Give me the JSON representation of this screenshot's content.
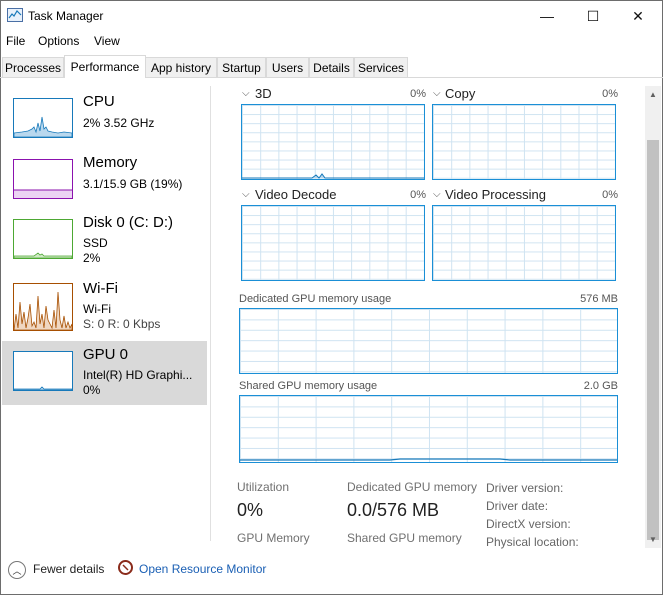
{
  "window": {
    "title": "Task Manager"
  },
  "controls": {
    "minimize": "—",
    "maximize": "☐",
    "close": "✕"
  },
  "menu": [
    "File",
    "Options",
    "View"
  ],
  "tabs": [
    "Processes",
    "Performance",
    "App history",
    "Startup",
    "Users",
    "Details",
    "Services"
  ],
  "active_tab": "Performance",
  "sidebar": {
    "items": [
      {
        "name": "CPU",
        "line1": "2%  3.52 GHz",
        "line2": "",
        "color": "#1779ba"
      },
      {
        "name": "Memory",
        "line1": "3.1/15.9 GB (19%)",
        "line2": "",
        "color": "#8b12ae"
      },
      {
        "name": "Disk 0 (C: D:)",
        "line1": "SSD",
        "line2": "2%",
        "color": "#4da833"
      },
      {
        "name": "Wi-Fi",
        "line1": "Wi-Fi",
        "line2": "S: 0  R: 0 Kbps",
        "color": "#a74f01"
      },
      {
        "name": "GPU 0",
        "line1": "Intel(R) HD Graphi...",
        "line2": "0%",
        "color": "#1779ba"
      }
    ]
  },
  "graphs": {
    "g3d": {
      "label": "3D",
      "pct": "0%"
    },
    "copy": {
      "label": "Copy",
      "pct": "0%"
    },
    "video_decode": {
      "label": "Video Decode",
      "pct": "0%"
    },
    "video_processing": {
      "label": "Video Processing",
      "pct": "0%"
    }
  },
  "memory_graphs": {
    "dedicated": {
      "label": "Dedicated GPU memory usage",
      "max": "576 MB"
    },
    "shared": {
      "label": "Shared GPU memory usage",
      "max": "2.0 GB"
    }
  },
  "stats": {
    "utilization_label": "Utilization",
    "utilization_value": "0%",
    "dedicated_label": "Dedicated GPU memory",
    "dedicated_value": "0.0/576 MB",
    "gpu_memory_label": "GPU Memory",
    "shared_label": "Shared GPU memory"
  },
  "info": {
    "driver_version": "Driver version:",
    "driver_date": "Driver date:",
    "directx_version": "DirectX version:",
    "physical_location": "Physical location:"
  },
  "footer": {
    "fewer_details": "Fewer details",
    "open_resource_monitor": "Open Resource Monitor"
  }
}
